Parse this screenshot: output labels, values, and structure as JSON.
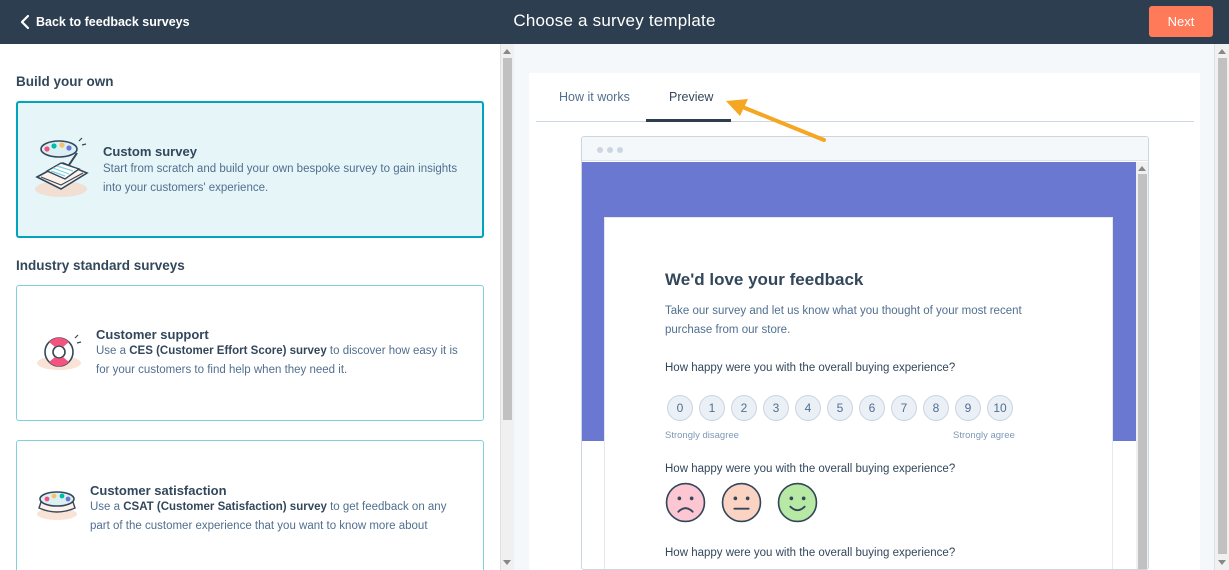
{
  "header": {
    "back_label": "Back to feedback surveys",
    "title": "Choose a survey template",
    "next_label": "Next"
  },
  "left": {
    "build_heading": "Build your own",
    "custom": {
      "title": "Custom survey",
      "desc": "Start from scratch and build your own bespoke survey to gain insights into your customers' experience."
    },
    "industry_heading": "Industry standard surveys",
    "support": {
      "title": "Customer support",
      "desc_pre": "Use a ",
      "desc_bold": "CES (Customer Effort Score) survey",
      "desc_post": " to discover how easy it is for your customers to find help when they need it."
    },
    "satisfaction": {
      "title": "Customer satisfaction",
      "desc_pre": "Use a ",
      "desc_bold": "CSAT (Customer Satisfaction) survey",
      "desc_post": " to get feedback on any part of the customer experience that you want to know more about"
    }
  },
  "tabs": {
    "how": "How it works",
    "preview": "Preview",
    "active": "Preview"
  },
  "preview": {
    "title": "We'd love your feedback",
    "intro": "Take our survey and let us know what you thought of your most recent purchase from our store.",
    "q1": "How happy were you with the overall buying experience?",
    "scale": [
      "0",
      "1",
      "2",
      "3",
      "4",
      "5",
      "6",
      "7",
      "8",
      "9",
      "10"
    ],
    "low_label": "Strongly disagree",
    "high_label": "Strongly agree",
    "q2": "How happy were you with the overall buying experience?",
    "faces": [
      "sad-face-icon",
      "neutral-face-icon",
      "happy-face-icon"
    ],
    "q3": "How happy were you with the overall buying experience?"
  },
  "colors": {
    "header_bg": "#2d3e50",
    "next_button": "#ff7a59",
    "selected_card_border": "#00a4bd",
    "selected_card_bg": "#e5f5f8",
    "preview_band": "#6a78d1",
    "annotation_arrow": "#f5a623"
  }
}
